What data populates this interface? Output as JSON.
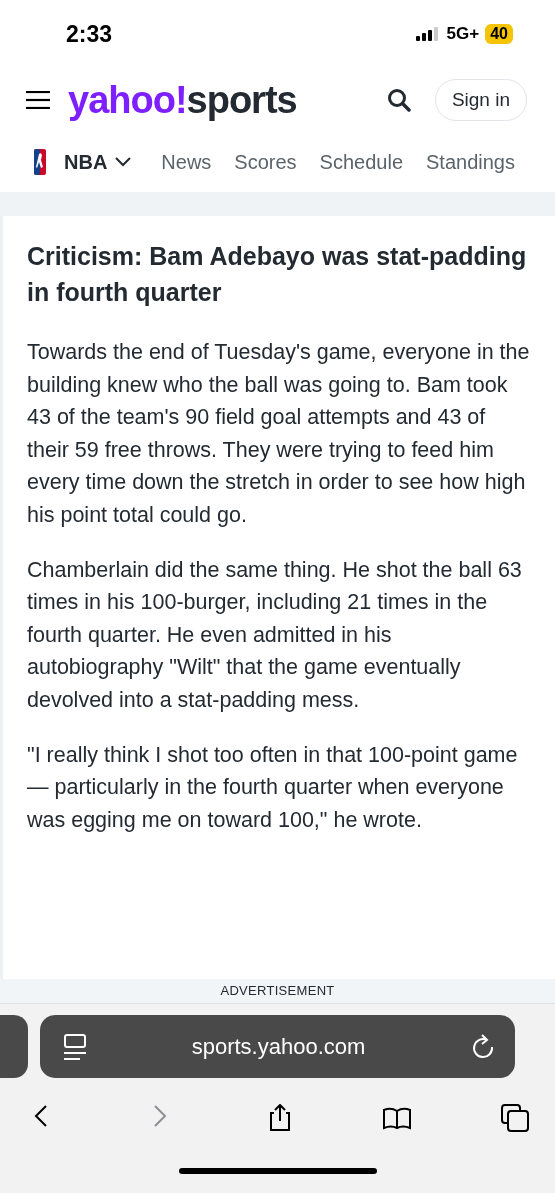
{
  "status_bar": {
    "time": "2:33",
    "network": "5G+",
    "battery": "40"
  },
  "header": {
    "logo": {
      "brand": "yahoo!",
      "section": "sports"
    },
    "sign_in": "Sign in"
  },
  "nav": [
    {
      "label": "NBA",
      "selected": true,
      "kind": "league"
    },
    {
      "label": "News",
      "selected": false,
      "kind": "link"
    },
    {
      "label": "Scores",
      "selected": false,
      "kind": "link"
    },
    {
      "label": "Schedule",
      "selected": false,
      "kind": "link"
    },
    {
      "label": "Standings",
      "selected": false,
      "kind": "link"
    }
  ],
  "article": {
    "heading": "Criticism: Bam Adebayo was stat-padding in fourth quarter",
    "paragraphs": [
      "Towards the end of Tuesday's game, everyone in the building knew who the ball was going to. Bam took 43 of the team's 90 field goal attempts and 43 of their 59 free throws. They were trying to feed him every time down the stretch in order to see how high his point total could go.",
      "Chamberlain did the same thing. He shot the ball 63 times in his 100-burger, including 21 times in the fourth quarter. He even admitted in his autobiography \"Wilt\" that the game eventually devolved into a stat-padding mess.",
      "\"I really think I shot too often in that 100-point game — particularly in the fourth quarter when everyone was egging me on toward 100,\" he wrote."
    ]
  },
  "ad_label": "ADVERTISEMENT",
  "browser": {
    "url": "sports.yahoo.com",
    "toolbar": [
      {
        "kind": "back",
        "disabled": false
      },
      {
        "kind": "forward",
        "disabled": true
      },
      {
        "kind": "share",
        "disabled": false
      },
      {
        "kind": "bookmarks",
        "disabled": false
      },
      {
        "kind": "tabs",
        "disabled": false
      }
    ]
  }
}
